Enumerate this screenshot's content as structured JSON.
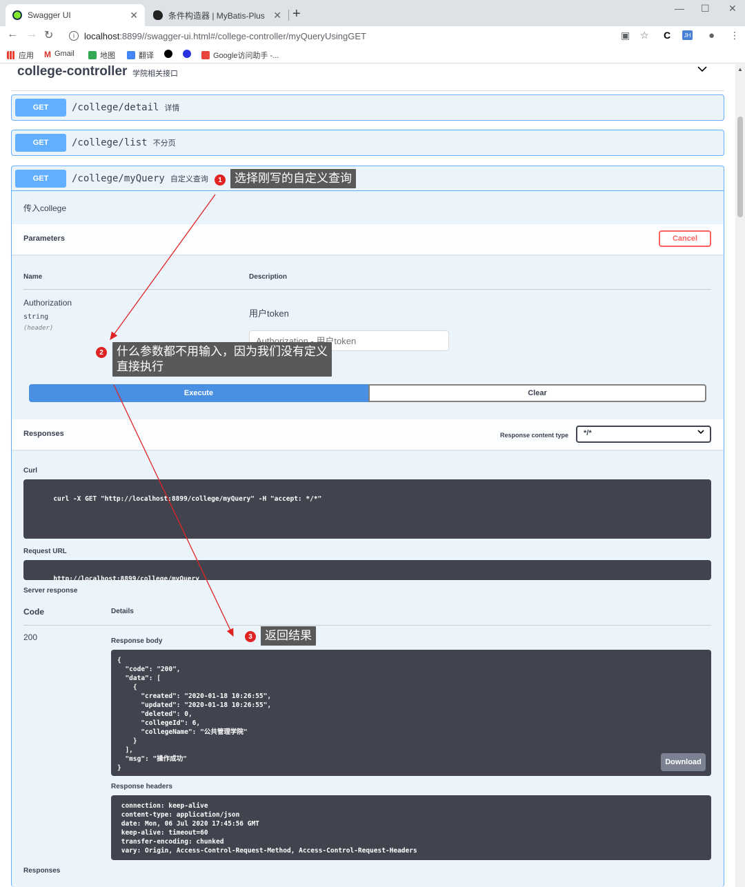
{
  "browser": {
    "tabs": [
      {
        "title": "Swagger UI",
        "active": true
      },
      {
        "title": "条件构造器 | MyBatis-Plus",
        "active": false
      }
    ],
    "url_host": "localhost",
    "url_rest": ":8899//swagger-ui.html#/college-controller/myQueryUsingGET",
    "bookmarks": [
      "应用",
      "Gmail",
      "地图",
      "翻译",
      "",
      "",
      "Google访问助手 -..."
    ],
    "badge_jh": "JH"
  },
  "tag": {
    "name": "college-controller",
    "description": "学院相关接口"
  },
  "operations": [
    {
      "method": "GET",
      "path": "/college/detail",
      "summary": "详情"
    },
    {
      "method": "GET",
      "path": "/college/list",
      "summary": "不分页"
    },
    {
      "method": "GET",
      "path": "/college/myQuery",
      "summary": "自定义查询"
    }
  ],
  "expanded": {
    "description": "传入college",
    "parameters_label": "Parameters",
    "cancel_label": "Cancel",
    "col_name": "Name",
    "col_description": "Description",
    "param": {
      "name": "Authorization",
      "type": "string",
      "in": "(header)",
      "description": "用户token",
      "placeholder": "Authorization - 用户token"
    },
    "execute_label": "Execute",
    "clear_label": "Clear",
    "responses_label": "Responses",
    "response_content_type_label": "Response content type",
    "response_content_type_value": "*/*",
    "curl_label": "Curl",
    "curl": "curl -X GET \"http://localhost:8899/college/myQuery\" -H \"accept: */*\"",
    "request_url_label": "Request URL",
    "request_url": "http://localhost:8899/college/myQuery",
    "server_response_label": "Server response",
    "code_label": "Code",
    "details_label": "Details",
    "status_code": "200",
    "response_body_label": "Response body",
    "response_body_lines": [
      "{",
      "  \"code\": \"200\",",
      "  \"data\": [",
      "    {",
      "      \"created\": \"2020-01-18 10:26:55\",",
      "      \"updated\": \"2020-01-18 10:26:55\",",
      "      \"deleted\": 0,",
      "      \"collegeId\": 6,",
      "      \"collegeName\": \"公共管理学院\"",
      "    }",
      "  ],",
      "  \"msg\": \"操作成功\"",
      "}"
    ],
    "download_label": "Download",
    "response_headers_label": "Response headers",
    "response_headers_lines": [
      " connection: keep-alive",
      " content-type: application/json",
      " date: Mon, 06 Jul 2020 17:45:56 GMT",
      " keep-alive: timeout=60",
      " transfer-encoding: chunked",
      " vary: Origin, Access-Control-Request-Method, Access-Control-Request-Headers"
    ],
    "responses_footer_label": "Responses"
  },
  "annotations": [
    {
      "num": "1",
      "text": "选择刚写的自定义查询"
    },
    {
      "num": "2",
      "text": "什么参数都不用输入，因为我们没有定义\n直接执行"
    },
    {
      "num": "3",
      "text": "返回结果"
    }
  ],
  "colors": {
    "get": "#61affe",
    "execute": "#4990e2",
    "cancel": "#ff6060",
    "code_bg": "#41444e",
    "annotation_red": "#e02424"
  }
}
